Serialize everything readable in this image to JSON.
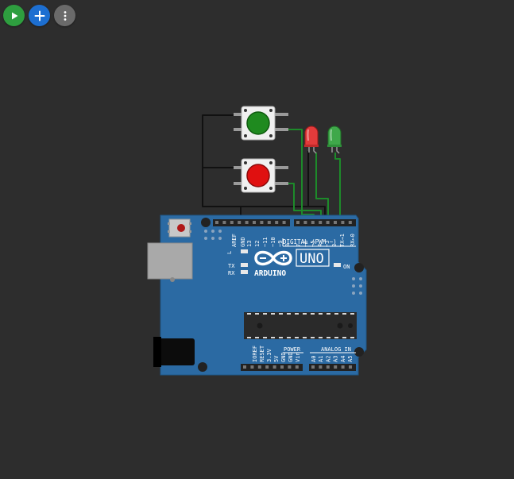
{
  "toolbar": {
    "play": {
      "icon": "play-icon",
      "color": "#2e9e3f"
    },
    "add": {
      "icon": "plus-icon",
      "color": "#1d6fd1"
    },
    "more": {
      "icon": "kebab-menu-icon",
      "color": "#6a6a6a"
    }
  },
  "board": {
    "logo_text": "UNO",
    "brand_text": "ARDUINO",
    "on_label": "ON",
    "tx_label": "TX",
    "rx_label": "RX",
    "l_label": "L",
    "digital_label": "DIGITAL (PWM ~)",
    "power_label": "POWER",
    "analog_label": "ANALOG IN",
    "digital_pins": [
      "AREF",
      "GND",
      "13",
      "12",
      "~11",
      "~10",
      "~9",
      "8",
      "7",
      "~6",
      "~5",
      "4",
      "~3",
      "2",
      "TX→1",
      "RX←0"
    ],
    "power_pins": [
      "IOREF",
      "RESET",
      "3.3V",
      "5V",
      "GND",
      "GND",
      "Vin"
    ],
    "analog_pins": [
      "A0",
      "A1",
      "A2",
      "A3",
      "A4",
      "A5"
    ],
    "colors": {
      "pcb": "#2b6aa3",
      "pcb_edge": "#1f5584",
      "header": "#222222",
      "chip": "#2a2a2a"
    }
  },
  "components": {
    "button_green_color": "#1f8a1f",
    "button_red_color": "#e01010",
    "led_red_color": "#e23b3b",
    "led_green_color": "#3fa84a",
    "wire_black": "#111111",
    "wire_green": "#1d8a2a"
  }
}
